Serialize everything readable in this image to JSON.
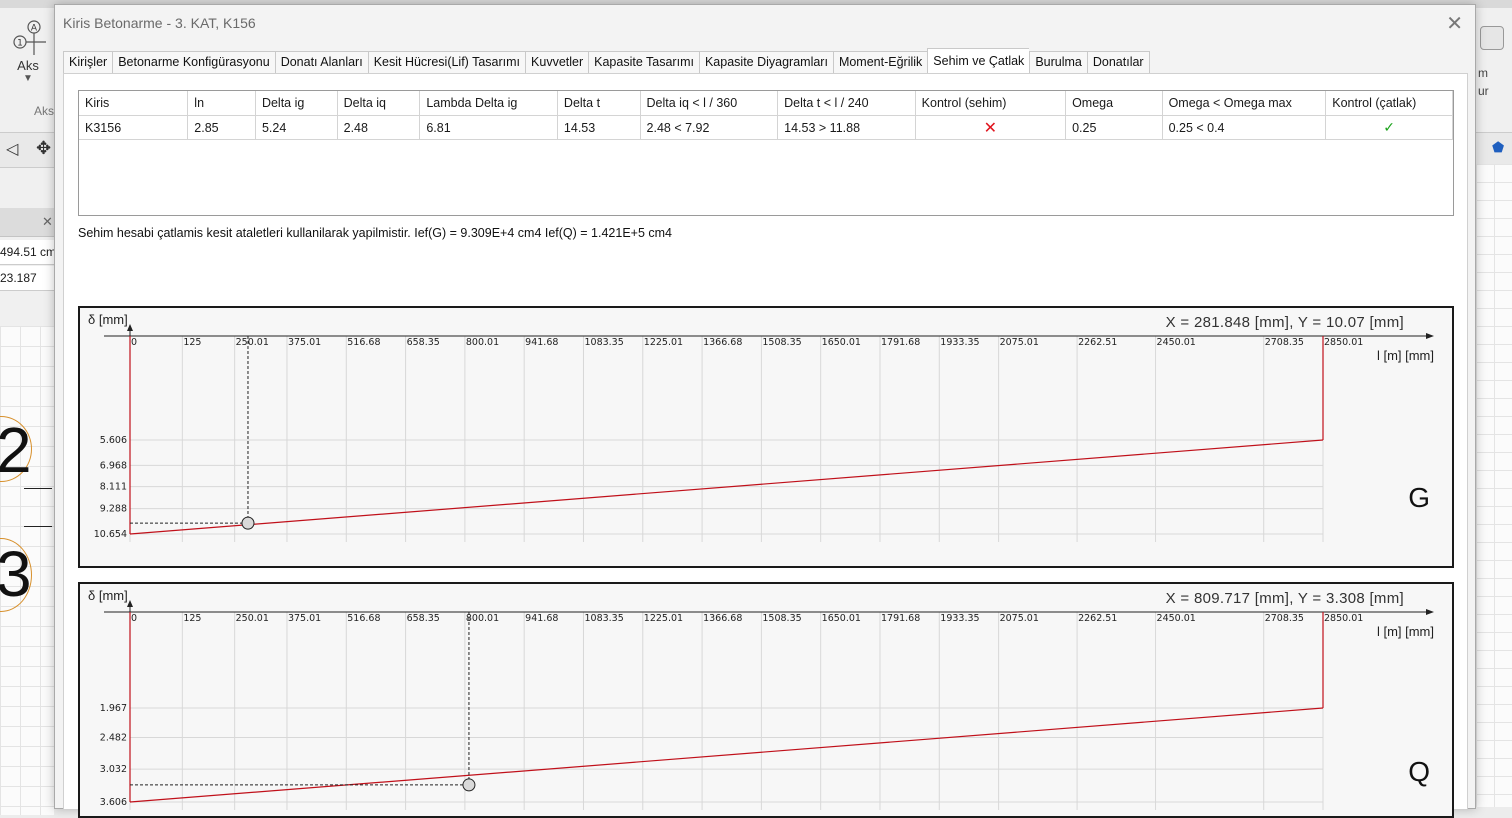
{
  "background": {
    "aks_label": "Aks",
    "aks_group_label": "Aks",
    "left_values": [
      "494.51 cm",
      "23.187"
    ],
    "axis_numbers": [
      "2",
      "3"
    ],
    "right_texts": [
      "m",
      "ur"
    ]
  },
  "dialog": {
    "title": "Kiris Betonarme - 3. KAT, K156",
    "tabs": [
      {
        "label": "Kirişler"
      },
      {
        "label": "Betonarme Konfigürasyonu"
      },
      {
        "label": "Donatı Alanları"
      },
      {
        "label": "Kesit Hücresi(Lif) Tasarımı"
      },
      {
        "label": "Kuvvetler"
      },
      {
        "label": "Kapasite Tasarımı"
      },
      {
        "label": "Kapasite Diyagramları"
      },
      {
        "label": "Moment-Eğrilik"
      },
      {
        "label": "Sehim ve Çatlak"
      },
      {
        "label": "Burulma"
      },
      {
        "label": "Donatılar"
      }
    ],
    "active_tab": "Sehim ve Çatlak"
  },
  "table": {
    "headers": [
      "Kiris",
      "ln",
      "Delta ig",
      "Delta iq",
      "Lambda Delta ig",
      "Delta t",
      "Delta iq < l / 360",
      "Delta t < l / 240",
      "Kontrol (sehim)",
      "Omega",
      "Omega < Omega max",
      "Kontrol (çatlak)"
    ],
    "row": {
      "kiris": "K3156",
      "ln": "2.85",
      "delta_ig": "5.24",
      "delta_iq": "2.48",
      "lambda_delta_ig": "6.81",
      "delta_t": "14.53",
      "delta_iq_check": "2.48 < 7.92",
      "delta_t_check": "14.53 > 11.88",
      "kontrol_sehim": "✕",
      "omega": "0.25",
      "omega_check": "0.25 < 0.4",
      "kontrol_catlak": "✓"
    },
    "status_colors": {
      "fail": "#e0141e",
      "pass": "#1aa31a"
    }
  },
  "note": "Sehim hesabi çatlamis kesit ataletleri kullanilarak yapilmistir. Ief(G) = 9.309E+4 cm4 Ief(Q) = 1.421E+5 cm4",
  "chart_data": [
    {
      "type": "line",
      "letter": "G",
      "ylabel": "δ [mm]",
      "xlabel": "l [m] [mm]",
      "readout": "X = 281.848 [mm],  Y = 10.07 [mm]",
      "x_ticks": [
        "0",
        "125",
        "250.01",
        "375.01",
        "516.68",
        "658.35",
        "800.01",
        "941.68",
        "1083.35",
        "1225.01",
        "1366.68",
        "1508.35",
        "1650.01",
        "1791.68",
        "1933.35",
        "2075.01",
        "2262.51",
        "2450.01",
        "2708.35",
        "2850.01"
      ],
      "x_tick_values": [
        0,
        125,
        250.01,
        375.01,
        516.68,
        658.35,
        800.01,
        941.68,
        1083.35,
        1225.01,
        1366.68,
        1508.35,
        1650.01,
        1791.68,
        1933.35,
        2075.01,
        2262.51,
        2450.01,
        2708.35,
        2850.01
      ],
      "y_ticks": [
        "5.606",
        "6.968",
        "8.111",
        "9.288",
        "10.654"
      ],
      "y_tick_values": [
        5.606,
        6.968,
        8.111,
        9.288,
        10.654
      ],
      "x_range": [
        0,
        2850.01
      ],
      "y_range": [
        0,
        10.654
      ],
      "series": [
        {
          "x": [
            0,
            2850.01
          ],
          "y": [
            10.654,
            5.606
          ]
        }
      ],
      "cursor": {
        "x": 281.848,
        "y": 10.07
      },
      "grid": true,
      "line_color": "#c0101a"
    },
    {
      "type": "line",
      "letter": "Q",
      "ylabel": "δ [mm]",
      "xlabel": "l [m] [mm]",
      "readout": "X = 809.717 [mm],  Y = 3.308 [mm]",
      "x_ticks": [
        "0",
        "125",
        "250.01",
        "375.01",
        "516.68",
        "658.35",
        "800.01",
        "941.68",
        "1083.35",
        "1225.01",
        "1366.68",
        "1508.35",
        "1650.01",
        "1791.68",
        "1933.35",
        "2075.01",
        "2262.51",
        "2450.01",
        "2708.35",
        "2850.01"
      ],
      "x_tick_values": [
        0,
        125,
        250.01,
        375.01,
        516.68,
        658.35,
        800.01,
        941.68,
        1083.35,
        1225.01,
        1366.68,
        1508.35,
        1650.01,
        1791.68,
        1933.35,
        2075.01,
        2262.51,
        2450.01,
        2708.35,
        2850.01
      ],
      "y_ticks": [
        "1.967",
        "2.482",
        "3.032",
        "3.606"
      ],
      "y_tick_values": [
        1.967,
        2.482,
        3.032,
        3.606
      ],
      "x_range": [
        0,
        2850.01
      ],
      "y_range": [
        0,
        3.606
      ],
      "series": [
        {
          "x": [
            0,
            2850.01
          ],
          "y": [
            3.606,
            1.967
          ]
        }
      ],
      "cursor": {
        "x": 809.717,
        "y": 3.308
      },
      "grid": true,
      "line_color": "#c0101a"
    }
  ]
}
